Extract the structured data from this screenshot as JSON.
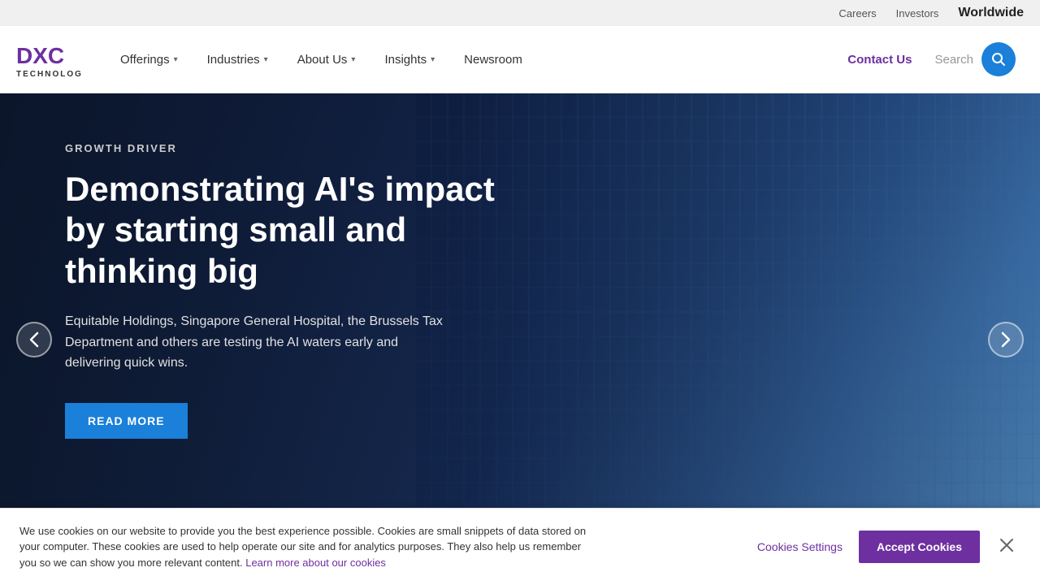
{
  "topbar": {
    "careers_label": "Careers",
    "investors_label": "Investors",
    "worldwide_label": "Worldwide"
  },
  "nav": {
    "logo_alt": "DXC Technology",
    "offerings_label": "Offerings",
    "industries_label": "Industries",
    "about_us_label": "About Us",
    "insights_label": "Insights",
    "newsroom_label": "Newsroom",
    "contact_us_label": "Contact Us",
    "search_placeholder": "Search"
  },
  "hero": {
    "label": "GROWTH DRIVER",
    "title": "Demonstrating AI's impact by starting small and thinking big",
    "description": "Equitable Holdings, Singapore General Hospital, the Brussels Tax Department and others are testing the AI waters early and delivering quick wins.",
    "cta_label": "READ MORE"
  },
  "carousel": {
    "dots": [
      {
        "id": "dot-1",
        "state": "active"
      },
      {
        "id": "dot-2",
        "state": "filled"
      },
      {
        "id": "dot-3",
        "state": "filled"
      }
    ]
  },
  "cookie": {
    "text": "We use cookies on our website to provide you the best experience possible. Cookies are small snippets of data stored on your computer. These cookies are used to help operate our site and for analytics purposes. They also help us remember you so we can show you more relevant content.",
    "link_text": "Learn more about our cookies",
    "settings_label": "Cookies Settings",
    "accept_label": "Accept Cookies"
  }
}
